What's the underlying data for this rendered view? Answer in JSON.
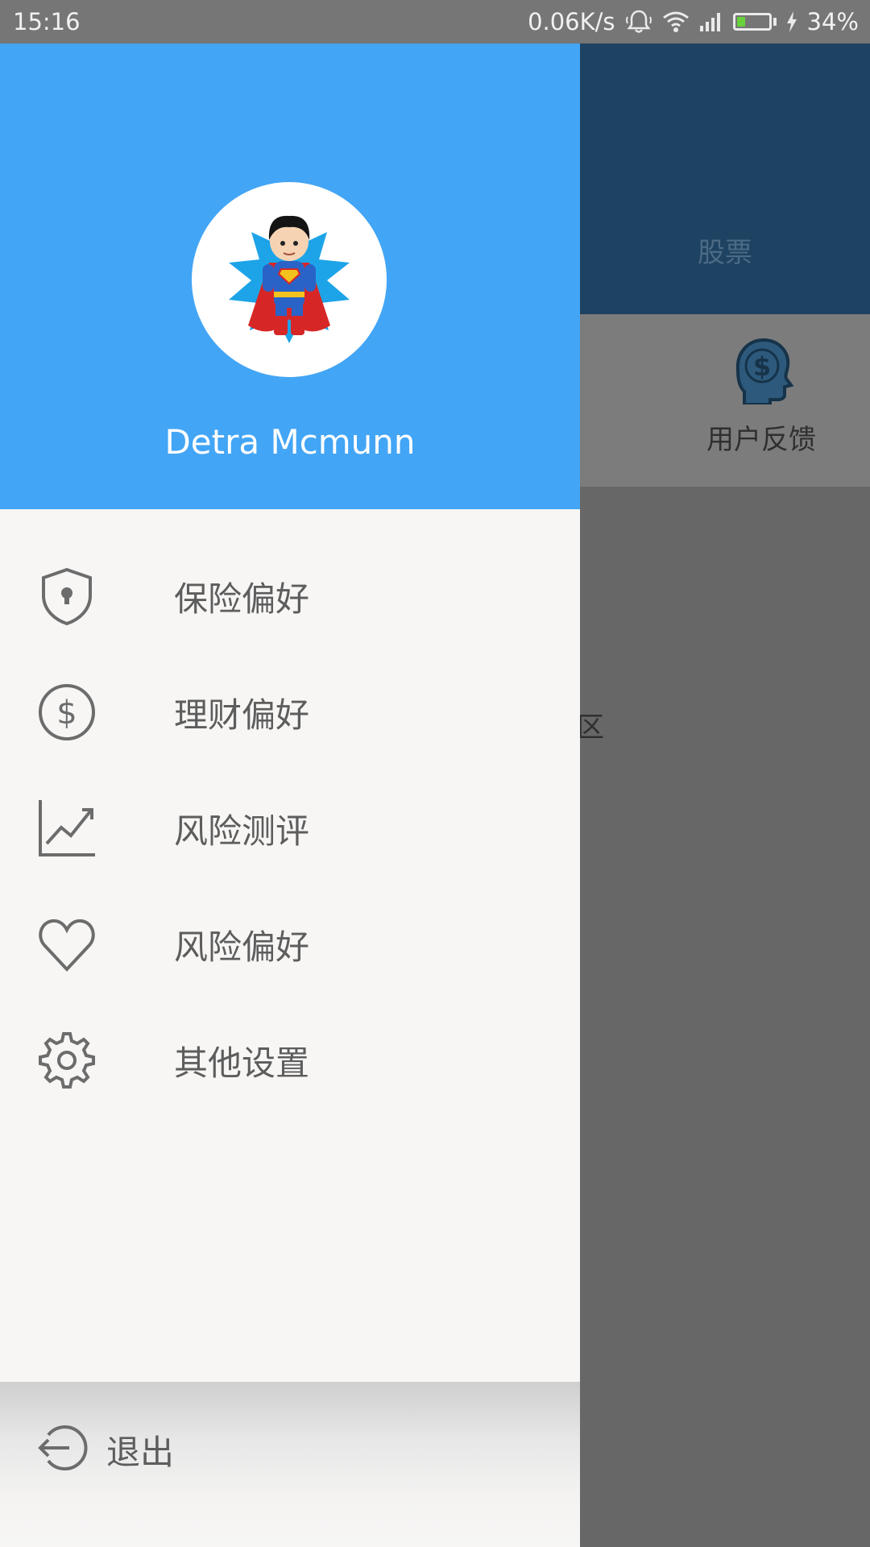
{
  "status_bar": {
    "time": "15:16",
    "network_speed": "0.06K/s",
    "battery_percent": "34%",
    "battery_level": 0.34
  },
  "background_app": {
    "tab_label": "股票",
    "feature_label": "用户反馈",
    "partial_label": "区"
  },
  "drawer": {
    "user_name": "Detra Mcmunn",
    "menu": [
      {
        "label": "保险偏好",
        "icon": "shield-lock-icon"
      },
      {
        "label": "理财偏好",
        "icon": "dollar-circle-icon"
      },
      {
        "label": "风险测评",
        "icon": "trend-chart-icon"
      },
      {
        "label": "风险偏好",
        "icon": "heart-icon"
      },
      {
        "label": "其他设置",
        "icon": "gear-icon"
      }
    ],
    "logout_label": "退出"
  },
  "colors": {
    "drawer_header": "#43a5f5",
    "drawer_bg": "#f7f6f5",
    "app_header": "#1e4262",
    "scrim": "#676767"
  }
}
